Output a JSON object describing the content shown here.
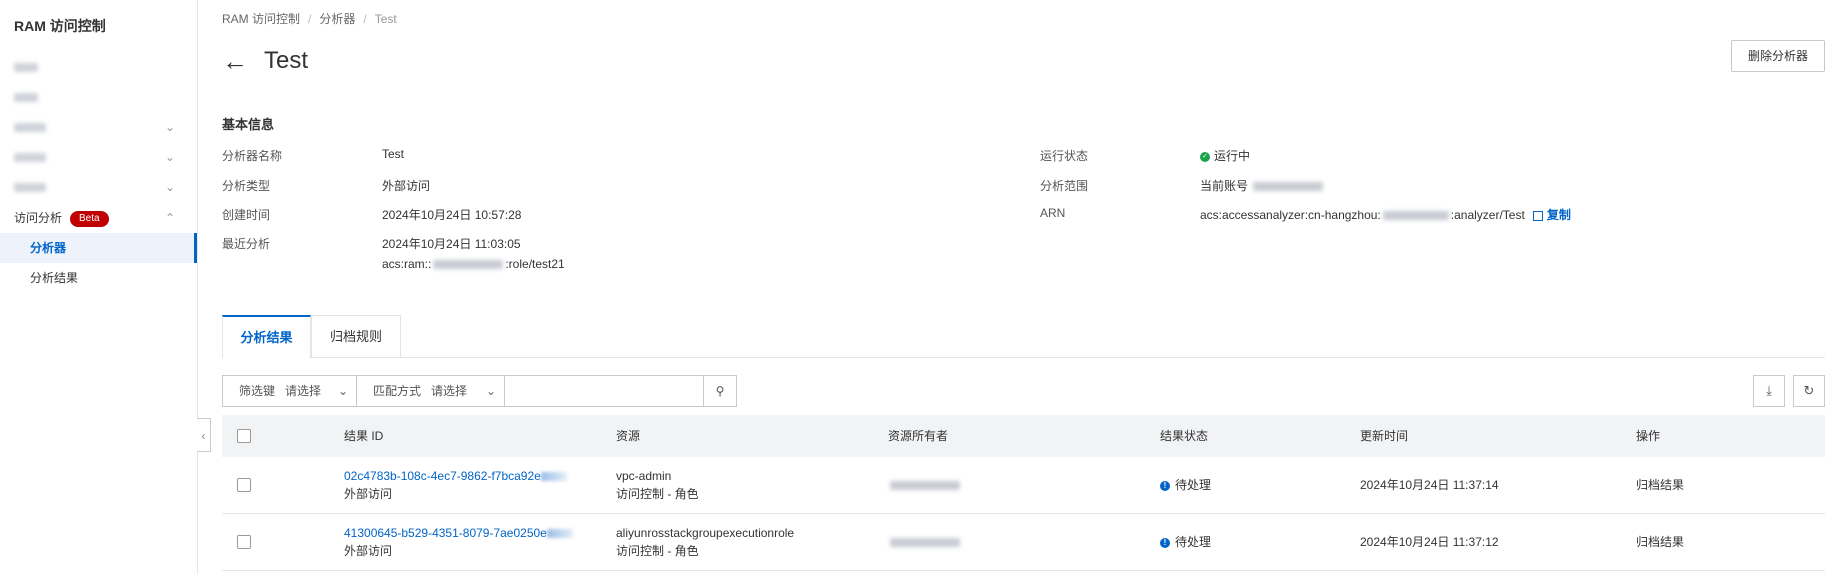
{
  "sidebar": {
    "title": "RAM 访问控制",
    "items": [
      {
        "label": "",
        "expandable": false
      },
      {
        "label": "",
        "expandable": false
      },
      {
        "label": "",
        "expandable": true
      },
      {
        "label": "",
        "expandable": true
      },
      {
        "label": "",
        "expandable": true
      }
    ],
    "group": {
      "label": "访问分析",
      "badge": "Beta"
    },
    "sub_items": [
      {
        "label": "分析器",
        "active": true
      },
      {
        "label": "分析结果",
        "active": false
      }
    ]
  },
  "breadcrumb": [
    "RAM 访问控制",
    "分析器",
    "Test"
  ],
  "header": {
    "title": "Test",
    "delete_button": "删除分析器"
  },
  "basic_info": {
    "heading": "基本信息",
    "left": [
      {
        "label": "分析器名称",
        "value": "Test"
      },
      {
        "label": "分析类型",
        "value": "外部访问"
      },
      {
        "label": "创建时间",
        "value": "2024年10月24日 10:57:28"
      },
      {
        "label": "最近分析",
        "value": "2024年10月24日 11:03:05"
      }
    ],
    "last_analysis_account_prefix": "acs:ram::",
    "last_analysis_account_suffix": ":role/test21",
    "right": {
      "status_label": "运行状态",
      "status_value": "运行中",
      "scope_label": "分析范围",
      "scope_value": "当前账号",
      "arn_label": "ARN",
      "arn_prefix": "acs:accessanalyzer:cn-hangzhou:",
      "arn_suffix": ":analyzer/Test",
      "copy_label": "复制"
    }
  },
  "tabs": [
    {
      "label": "分析结果",
      "active": true
    },
    {
      "label": "归档规则",
      "active": false
    }
  ],
  "filter": {
    "key_label": "筛选键",
    "key_placeholder": "请选择",
    "match_label": "匹配方式",
    "match_placeholder": "请选择"
  },
  "table": {
    "columns": [
      "结果 ID",
      "资源",
      "资源所有者",
      "结果状态",
      "更新时间",
      "操作"
    ],
    "rows": [
      {
        "id": "02c4783b-108c-4ec7-9862-f7bca92e",
        "type": "外部访问",
        "resource": "vpc-admin",
        "resource_type": "访问控制 - 角色",
        "status": "待处理",
        "updated": "2024年10月24日 11:37:14",
        "action": "归档结果"
      },
      {
        "id": "41300645-b529-4351-8079-7ae0250e",
        "type": "外部访问",
        "resource": "aliyunrosstackgroupexecutionrole",
        "resource_type": "访问控制 - 角色",
        "status": "待处理",
        "updated": "2024年10月24日 11:37:12",
        "action": "归档结果"
      }
    ]
  },
  "colors": {
    "accent": "#0064c8",
    "success": "#1aa34a",
    "beta": "#c00000"
  },
  "icons": [
    "arrow-left-icon",
    "chevron-down-icon",
    "chevron-up-icon",
    "chevron-left-icon",
    "search-icon",
    "download-icon",
    "refresh-icon",
    "copy-icon",
    "check-circle-icon",
    "info-circle-icon"
  ]
}
